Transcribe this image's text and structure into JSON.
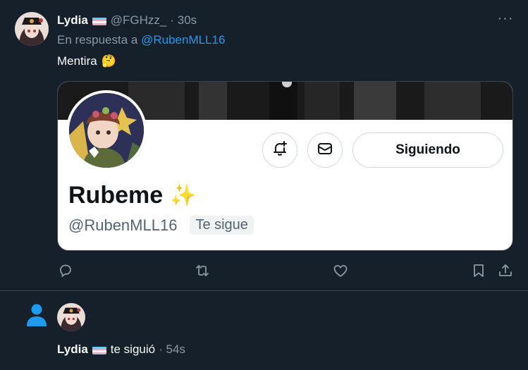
{
  "tweet": {
    "author_name": "Lydia",
    "author_handle": "@FGHzz_",
    "time": "· 30s",
    "more_label": "···",
    "reply_prefix": "En respuesta a",
    "reply_handle": "@RubenMLL16",
    "text": "Mentira",
    "text_emoji": "🤔"
  },
  "card": {
    "display_name": "Rubeme",
    "display_emoji": "✨",
    "handle": "@RubenMLL16",
    "follows_you": "Te sigue",
    "follow_button": "Siguiendo",
    "icons": [
      "notification-bell-icon",
      "message-envelope-icon"
    ]
  },
  "actions": [
    "reply-icon",
    "retweet-icon",
    "like-icon",
    "bookmark-icon",
    "share-icon"
  ],
  "notification": {
    "icon": "person-icon",
    "actor_name": "Lydia",
    "action_text": "te siguió",
    "time": "· 54s"
  },
  "colors": {
    "background": "#15202b",
    "text": "#f7f9f9",
    "muted": "#8b98a5",
    "accent": "#1d9bf0",
    "divider": "#38444d"
  }
}
